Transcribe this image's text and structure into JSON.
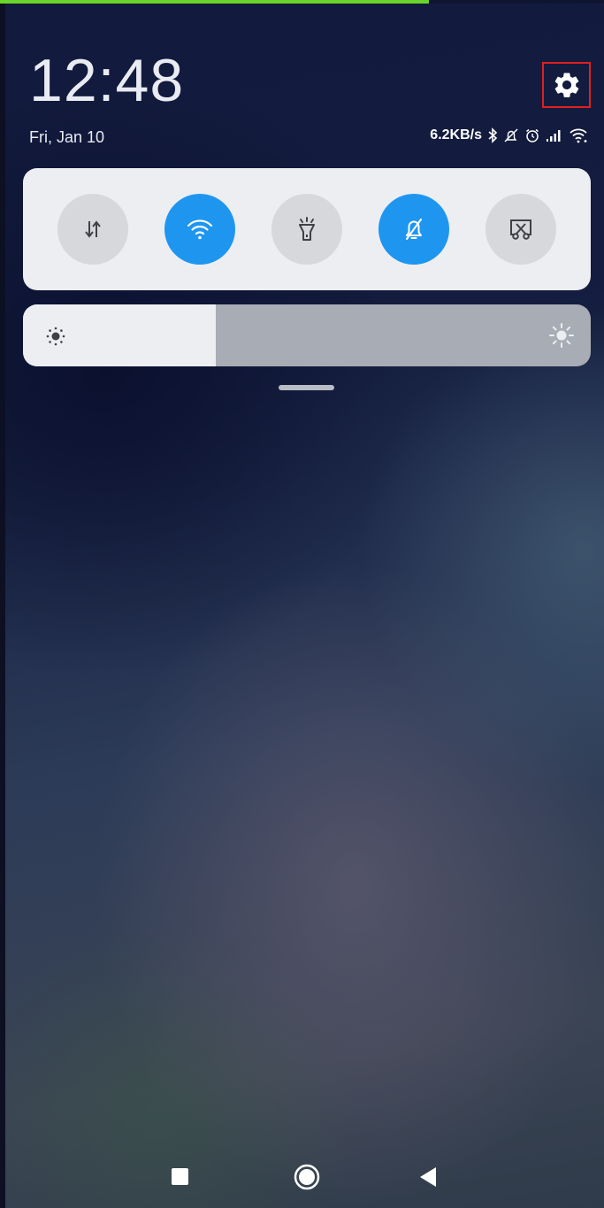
{
  "top_progress": {
    "value": 0.71,
    "color": "#6bd32a"
  },
  "clock": {
    "time": "12:48",
    "date": "Fri, Jan 10"
  },
  "status_bar": {
    "network_speed": "6.2KB/s",
    "icons": [
      "bluetooth-icon",
      "alarm-off-icon",
      "alarm-clock-icon",
      "signal-icon",
      "wifi-icon"
    ]
  },
  "quick_settings": {
    "tiles": [
      {
        "name": "mobile-data",
        "icon": "data-arrows-icon",
        "active": false
      },
      {
        "name": "wifi",
        "icon": "wifi-icon",
        "active": true
      },
      {
        "name": "flashlight",
        "icon": "flashlight-icon",
        "active": false
      },
      {
        "name": "silent",
        "icon": "bell-off-icon",
        "active": true
      },
      {
        "name": "screenshot",
        "icon": "scissors-screen-icon",
        "active": false
      }
    ],
    "active_color": "#1e96f0"
  },
  "brightness": {
    "level": 0.34
  },
  "settings": {
    "icon": "gear-icon"
  },
  "nav": {
    "icons": [
      "recent-apps-icon",
      "home-icon",
      "back-icon"
    ]
  }
}
